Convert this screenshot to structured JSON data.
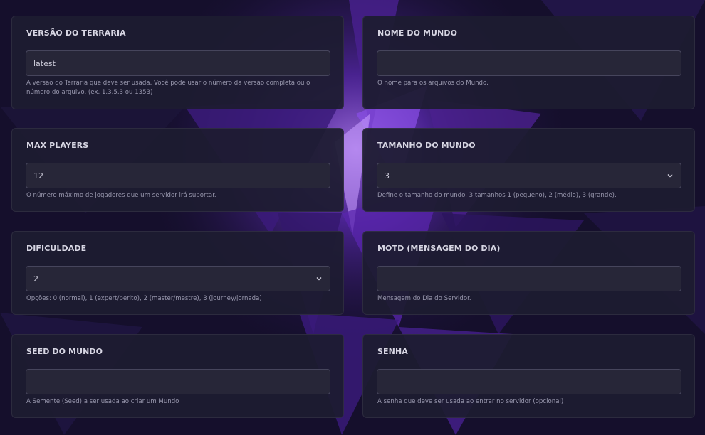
{
  "fields": {
    "terraria_version": {
      "label": "VERSÃO DO TERRARIA",
      "value": "latest",
      "help": "A versão do Terraria que deve ser usada. Você pode usar o número da versão completa ou o número do arquivo. (ex. 1.3.5.3 ou 1353)"
    },
    "world_name": {
      "label": "NOME DO MUNDO",
      "value": "",
      "help": "O nome para os arquivos do Mundo."
    },
    "max_players": {
      "label": "MAX PLAYERS",
      "value": "12",
      "help": "O número máximo de jogadores que um servidor irá suportar."
    },
    "world_size": {
      "label": "TAMANHO DO MUNDO",
      "value": "3",
      "help": "Define o tamanho do mundo. 3 tamanhos 1 (pequeno), 2 (médio), 3 (grande)."
    },
    "difficulty": {
      "label": "DIFICULDADE",
      "value": "2",
      "help": "Opções: 0 (normal), 1 (expert/perito), 2 (master/mestre), 3 (journey/jornada)"
    },
    "motd": {
      "label": "MOTD (MENSAGEM DO DIA)",
      "value": "",
      "help": "Mensagem do Dia do Servidor."
    },
    "world_seed": {
      "label": "SEED DO MUNDO",
      "value": "",
      "help": "A Semente (Seed) a ser usada ao criar um Mundo"
    },
    "password": {
      "label": "SENHA",
      "value": "",
      "help": "A senha que deve ser usada ao entrar no servidor (opcional)"
    }
  },
  "icons": {
    "select_chevron": "chevron-down-icon"
  },
  "colors": {
    "card_background": "#1d1c30",
    "input_background": "#272638",
    "input_border": "#46455c",
    "label_text": "#d7d6e3",
    "help_text": "#9897ad",
    "background_accent": "#7b3fe0"
  }
}
